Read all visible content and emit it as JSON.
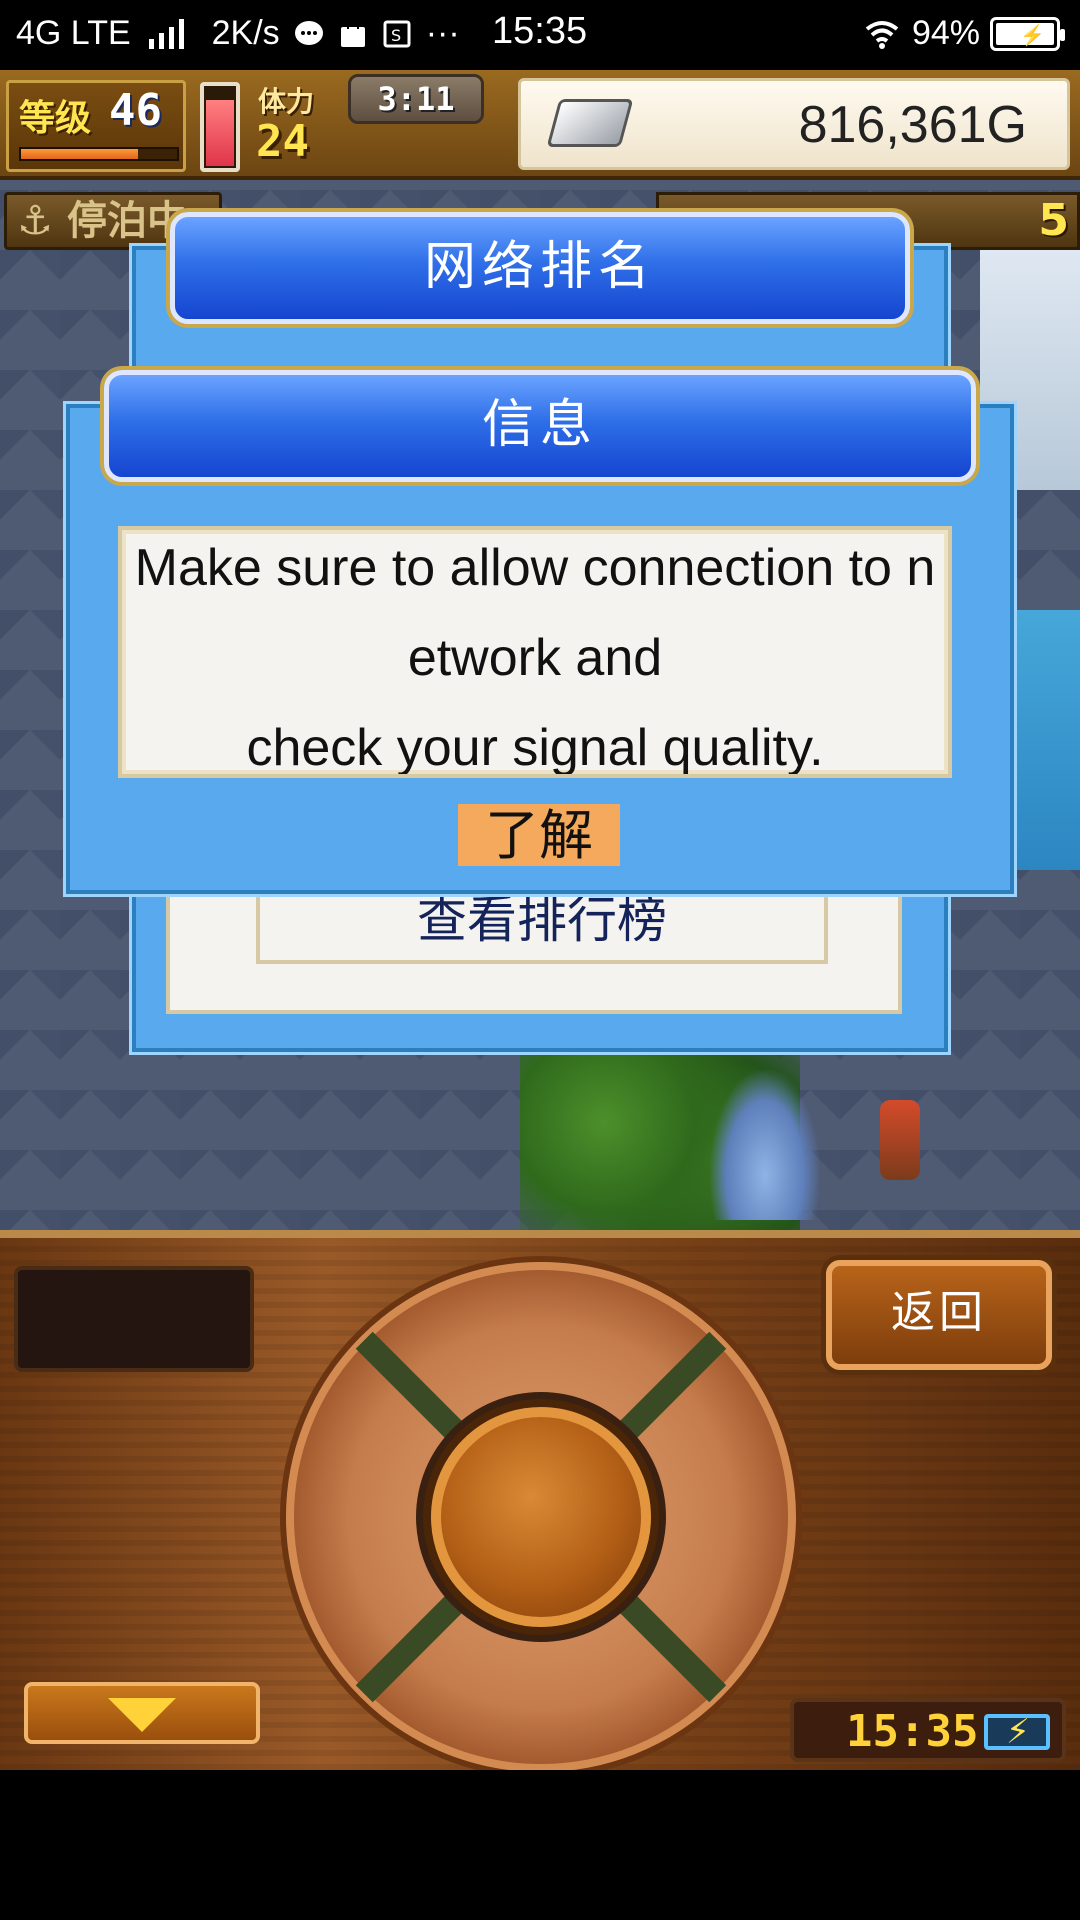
{
  "status_bar": {
    "network": "4G LTE",
    "speed": "2K/s",
    "more": "···",
    "time": "15:35",
    "battery": "94%",
    "icons": [
      "signal-icon",
      "chat-icon",
      "shopping-bag-icon",
      "screenshot-icon",
      "wifi-icon",
      "battery-charging-icon"
    ]
  },
  "hud": {
    "level_label": "等级",
    "level_value": "46",
    "xp_progress": 0.75,
    "stamina_label": "体力",
    "stamina_value": "24",
    "stamina_fill": 0.85,
    "timer": "3:11",
    "money": "816,361G",
    "dock_status": "停泊中",
    "resource_count": "5"
  },
  "dialog_back": {
    "title": "网络排名",
    "view_ranking_label": "查看排行榜"
  },
  "dialog_front": {
    "title": "信息",
    "message_lines": [
      "Make sure to allow connection to n",
      "etwork and",
      "check your signal quality."
    ],
    "ok_label": "了解"
  },
  "controls": {
    "back_label": "返回",
    "clock": "15:35"
  },
  "colors": {
    "dialog_blue": "#58a9ee",
    "banner_blue": "#1545d0",
    "ok_button": "#f4a95c",
    "paper": "#f4f3ef"
  }
}
